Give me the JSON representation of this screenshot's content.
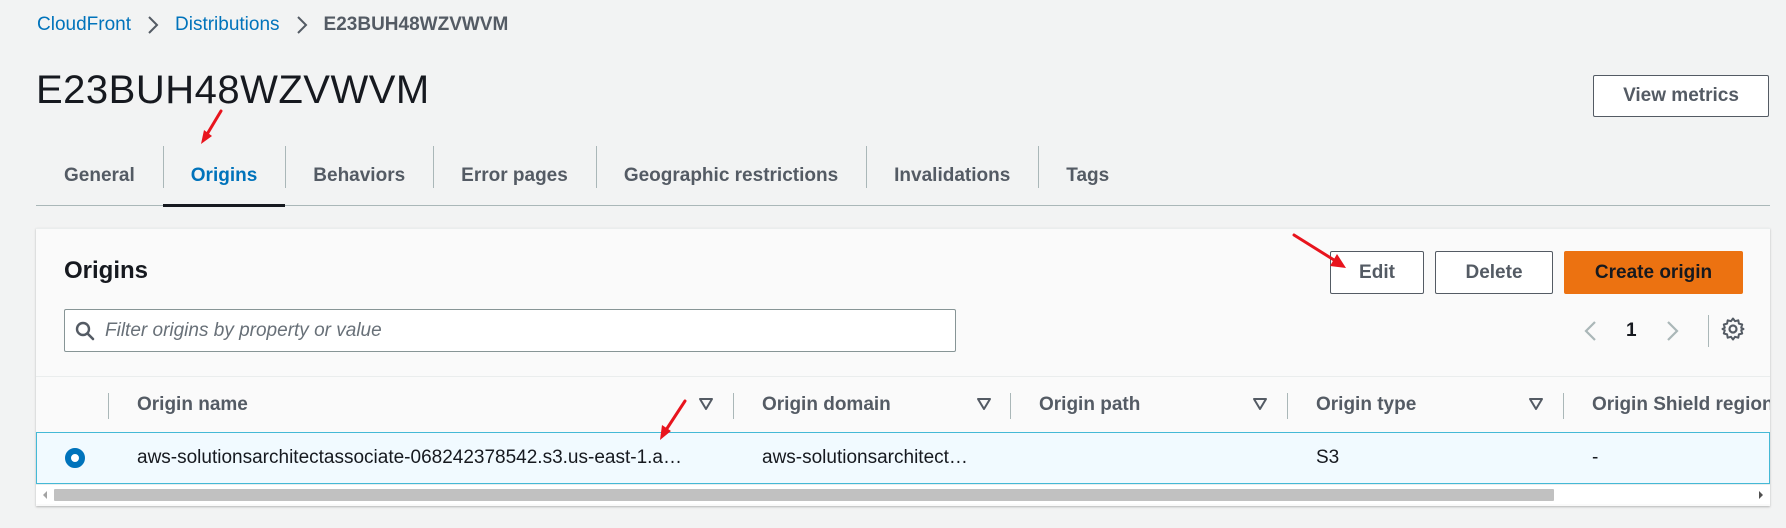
{
  "breadcrumb": {
    "items": [
      "CloudFront",
      "Distributions",
      "E23BUH48WZVWVM"
    ]
  },
  "page": {
    "title": "E23BUH48WZVWVM",
    "view_metrics_label": "View metrics"
  },
  "tabs": [
    {
      "label": "General",
      "active": false
    },
    {
      "label": "Origins",
      "active": true
    },
    {
      "label": "Behaviors",
      "active": false
    },
    {
      "label": "Error pages",
      "active": false
    },
    {
      "label": "Geographic restrictions",
      "active": false
    },
    {
      "label": "Invalidations",
      "active": false
    },
    {
      "label": "Tags",
      "active": false
    }
  ],
  "origins_panel": {
    "title": "Origins",
    "edit_label": "Edit",
    "delete_label": "Delete",
    "create_label": "Create origin",
    "search_placeholder": "Filter origins by property or value",
    "search_value": "",
    "page_number": "1",
    "columns": [
      "Origin name",
      "Origin domain",
      "Origin path",
      "Origin type",
      "Origin Shield region"
    ],
    "rows": [
      {
        "selected": true,
        "origin_name": "aws-solutionsarchitectassociate-068242378542.s3.us-east-1.a…",
        "origin_domain": "aws-solutionsarchitect…",
        "origin_path": "",
        "origin_type": "S3",
        "origin_shield_region": "-"
      }
    ]
  },
  "colors": {
    "link": "#0073bb",
    "primary_button": "#ec7211",
    "selected_row_bg": "#f1faff",
    "selected_row_border": "#44b9d6",
    "annotation_arrow": "#e8141d"
  },
  "icons": [
    "chevron-right-icon",
    "search-icon",
    "chevron-left-icon",
    "gear-icon",
    "sort-triangle-icon",
    "radio-selected-icon",
    "annotation-arrow-icon"
  ]
}
